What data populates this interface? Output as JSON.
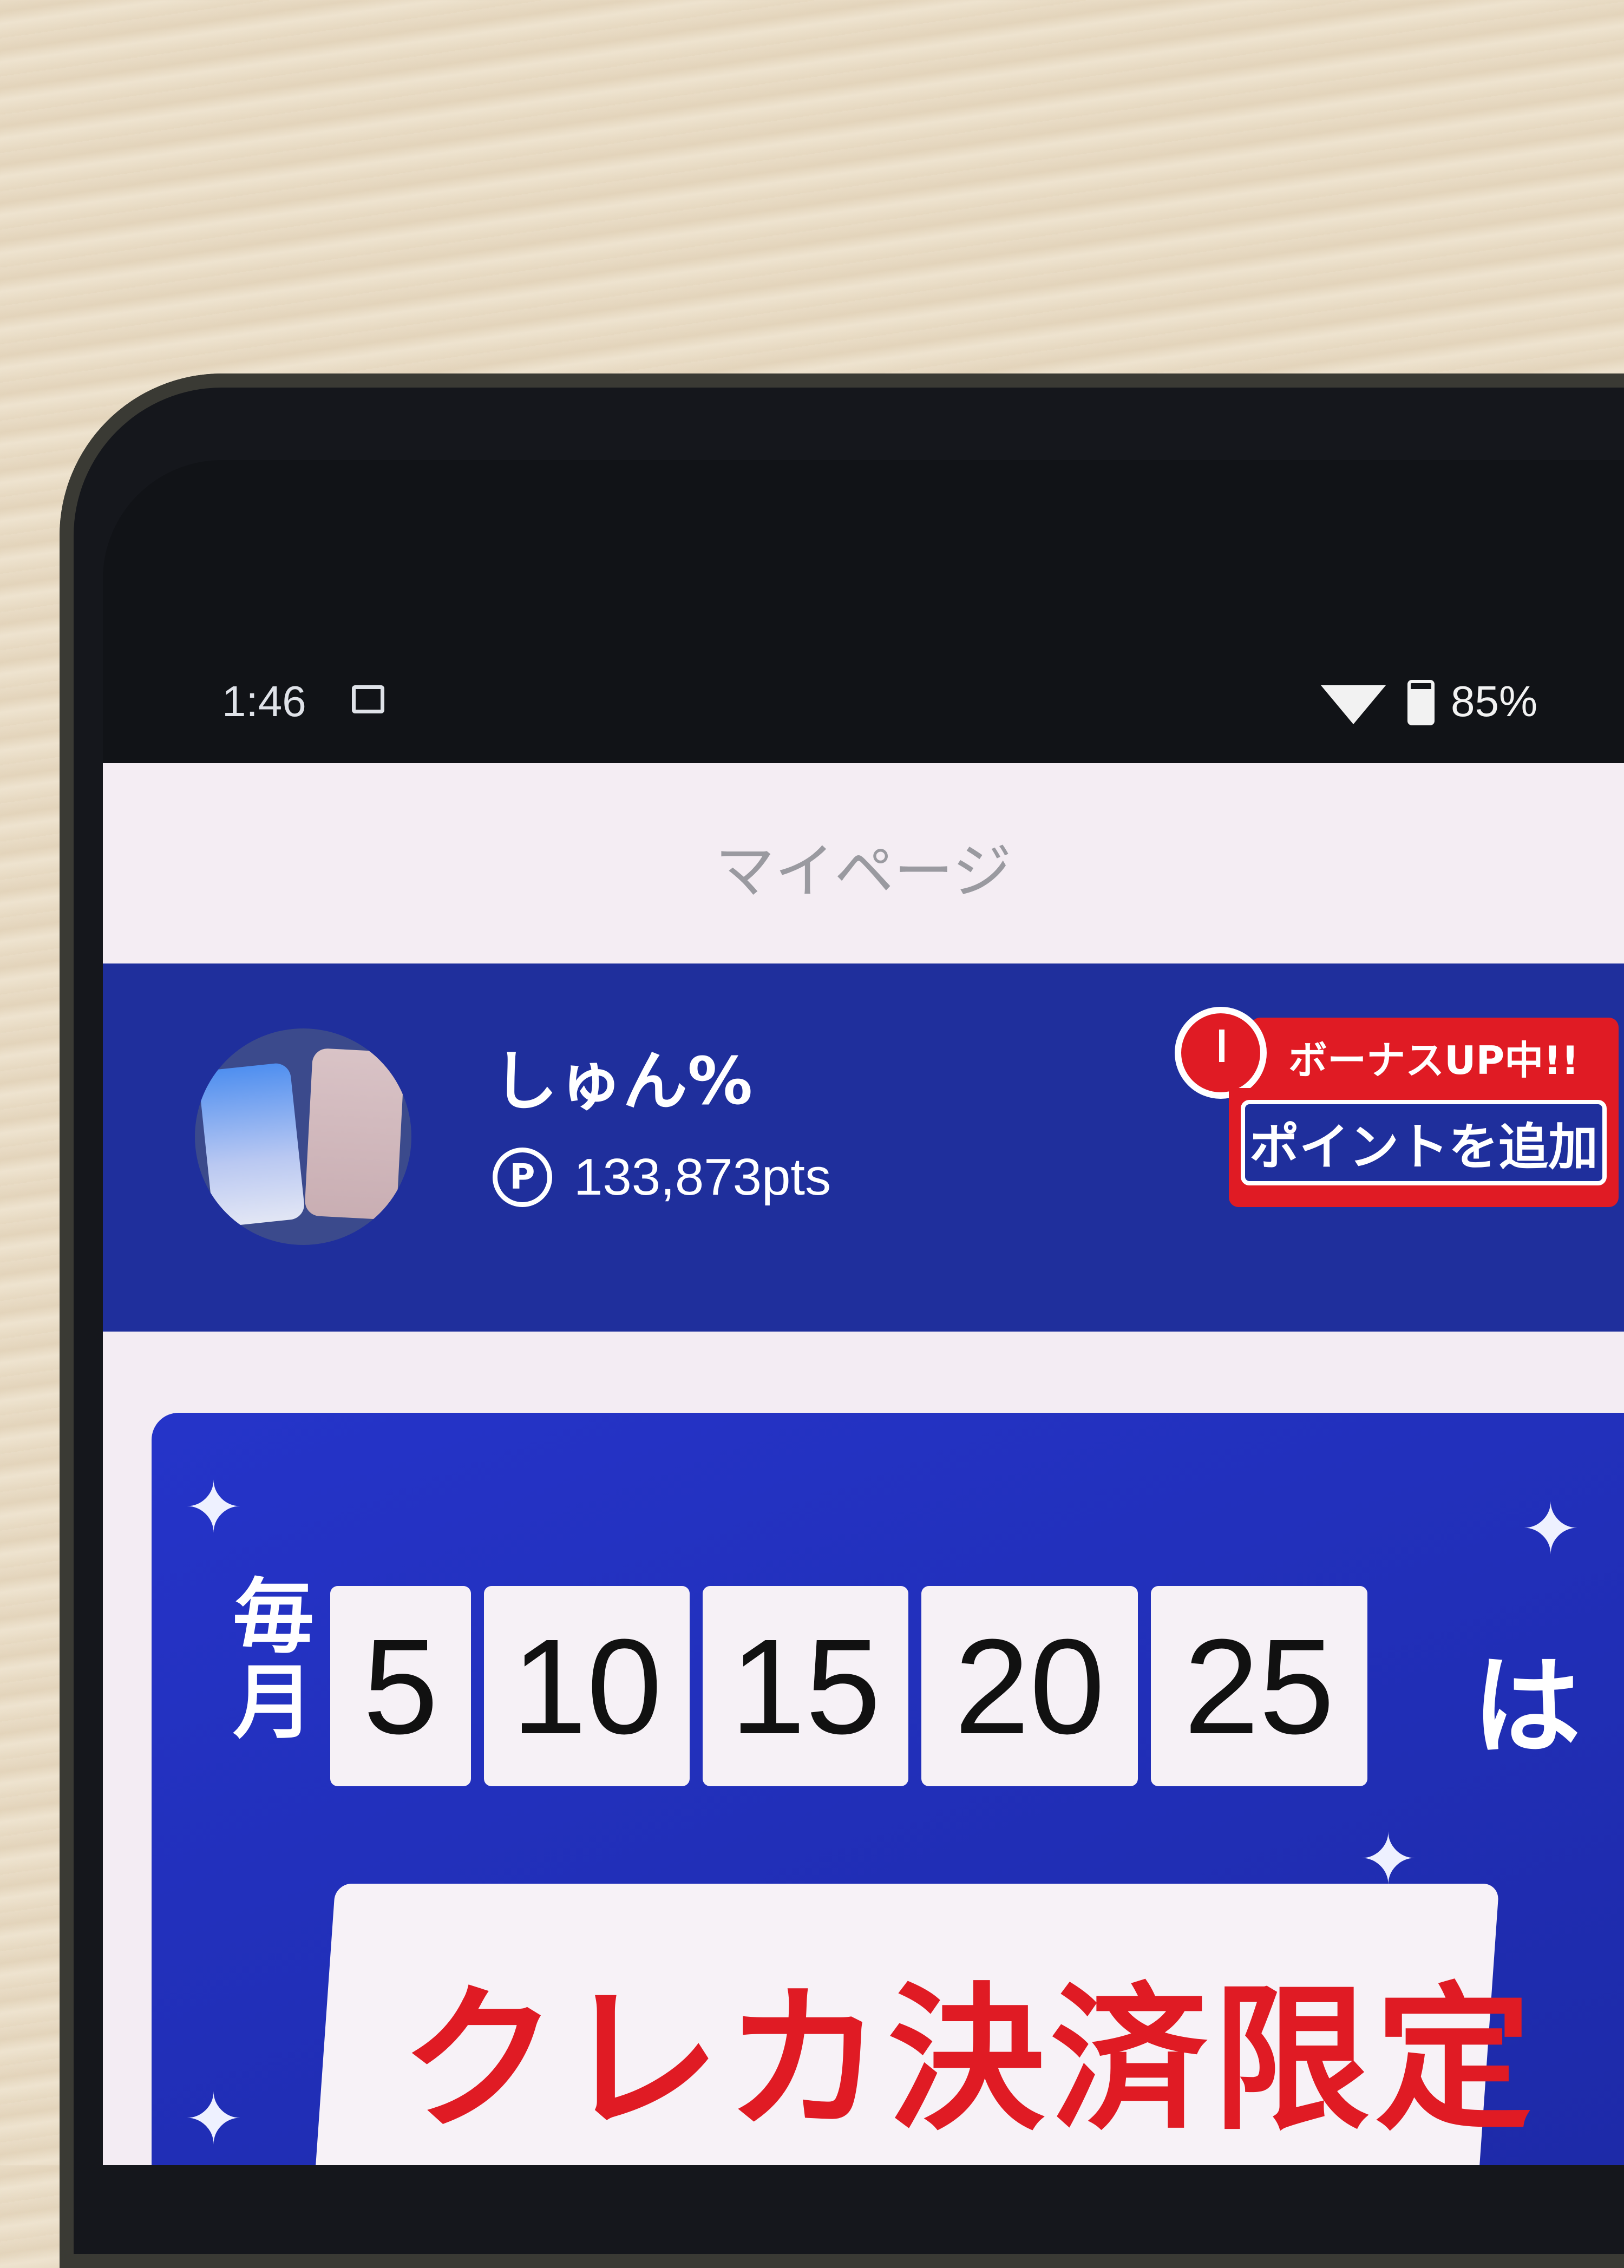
{
  "status_bar": {
    "time": "1:46",
    "battery": "85%"
  },
  "header": {
    "title": "マイページ"
  },
  "profile": {
    "name": "しゅん%",
    "points_symbol": "P",
    "points": "133,873pts",
    "bonus_label": "ボーナスUP中!!",
    "add_points_label": "ポイントを追加"
  },
  "promo": {
    "monthly_label": "毎月",
    "dates": [
      "5",
      "10",
      "15",
      "20",
      "25"
    ],
    "suffix": "は",
    "headline": "クレカ決済限定"
  },
  "colors": {
    "brand_blue": "#1f2f9c",
    "accent_red": "#e01b24",
    "background": "#f3ecf3"
  },
  "icons": [
    "cast-icon",
    "wifi-icon",
    "battery-icon",
    "points-coin-icon",
    "alarm-clock-icon",
    "sparkle-icon"
  ]
}
